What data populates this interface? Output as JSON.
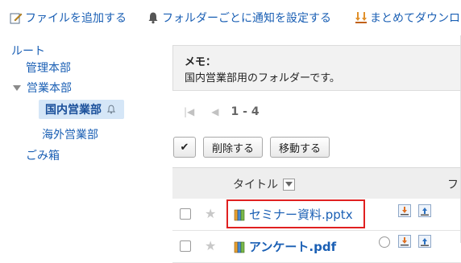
{
  "toolbar": {
    "add_file": "ファイルを追加する",
    "folder_notify": "フォルダーごとに通知を設定する",
    "bulk_download": "まとめてダウンロ"
  },
  "tree": {
    "root": "ルート",
    "admin": "管理本部",
    "sales": "営業本部",
    "domestic": "国内営業部",
    "overseas": "海外営業部",
    "trash": "ごみ箱"
  },
  "memo": {
    "title": "メモ：",
    "body": "国内営業部用のフォルダーです。"
  },
  "pager": {
    "first": "|◀",
    "prev": "◀",
    "range": "1 - 4"
  },
  "actions": {
    "check": "✔",
    "delete": "削除する",
    "move": "移動する"
  },
  "table": {
    "col_title": "タイトル",
    "col_next": "フ",
    "rows": [
      {
        "name": "セミナー資料.pptx"
      },
      {
        "name": "アンケート.pdf"
      }
    ]
  },
  "colors": {
    "link": "#1a5fb4",
    "selected_bg": "#d5e6f7",
    "highlight": "#e02020"
  }
}
